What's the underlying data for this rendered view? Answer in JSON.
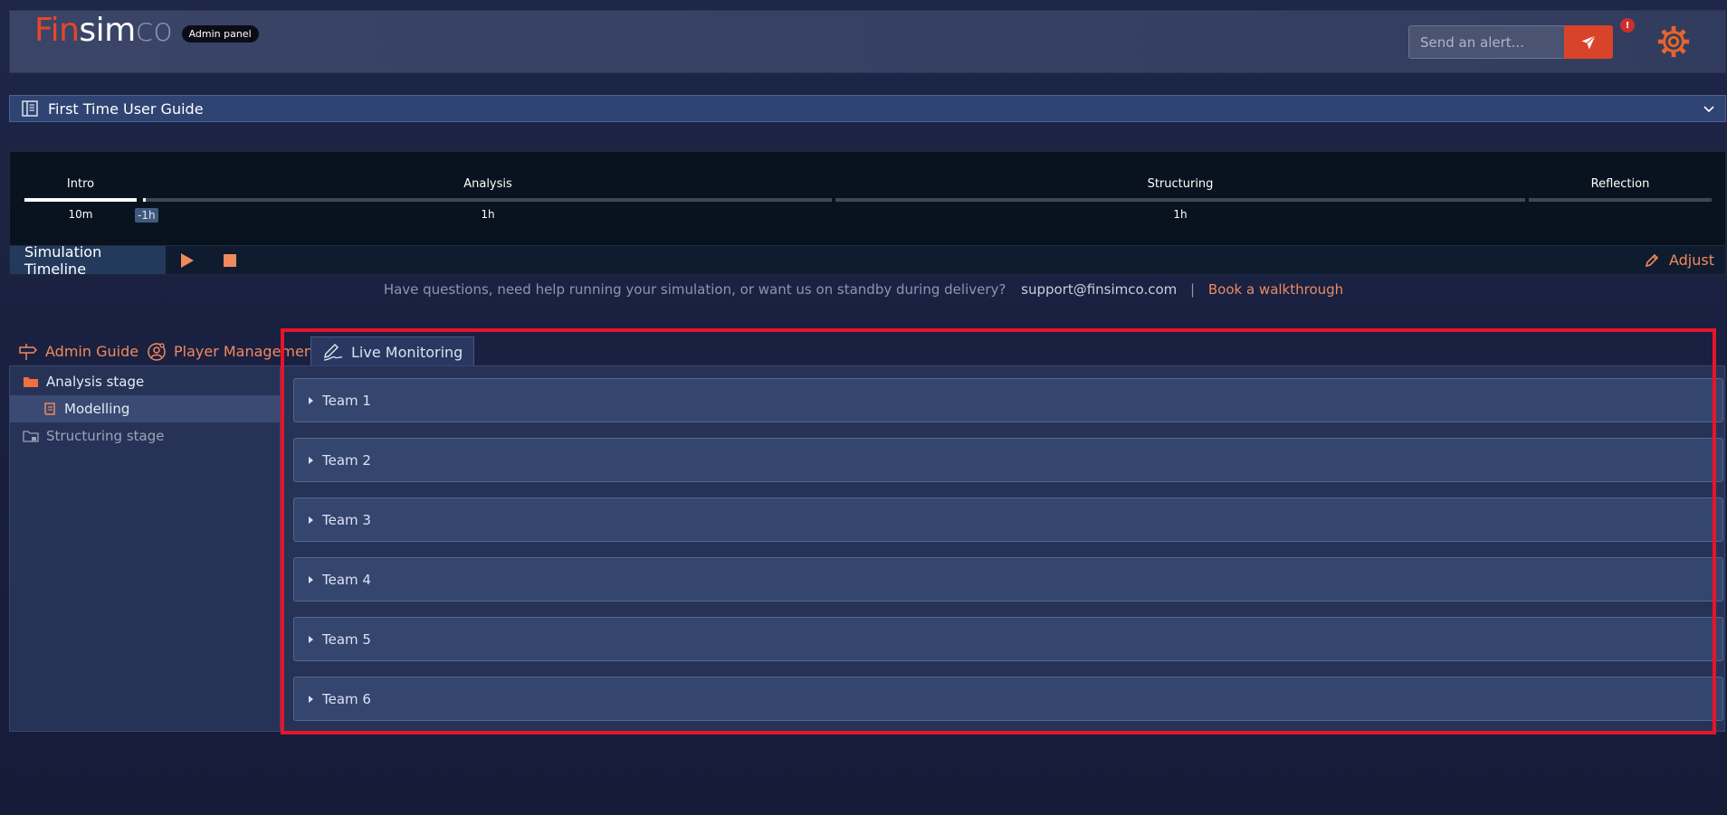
{
  "header": {
    "logo": {
      "part1": "Fin",
      "part2": "sim",
      "part3": "co"
    },
    "badge": "Admin panel",
    "alert_placeholder": "Send an alert...",
    "notification_count": "!"
  },
  "guide": {
    "title": "First Time User Guide"
  },
  "timeline": {
    "phases": [
      {
        "name": "Intro",
        "duration": "10m"
      },
      {
        "name": "Analysis",
        "duration": "1h"
      },
      {
        "name": "Structuring",
        "duration": "1h"
      },
      {
        "name": "Reflection",
        "duration": ""
      }
    ],
    "offset": "-1h",
    "label": "Simulation Timeline",
    "adjust_label": "Adjust"
  },
  "support": {
    "question": "Have questions, need help running your simulation, or want us on standby during delivery?",
    "email": "support@finsimco.com",
    "separator": "|",
    "book_link": "Book a walkthrough"
  },
  "tabs": [
    {
      "label": "Admin Guide",
      "active": false
    },
    {
      "label": "Player Management",
      "active": false
    },
    {
      "label": "Live Monitoring",
      "active": true
    }
  ],
  "tree": {
    "items": [
      {
        "label": "Analysis stage",
        "type": "folder-open"
      },
      {
        "label": "Modelling",
        "type": "file"
      },
      {
        "label": "Structuring stage",
        "type": "folder-locked"
      }
    ]
  },
  "teams": [
    "Team 1",
    "Team 2",
    "Team 3",
    "Team 4",
    "Team 5",
    "Team 6"
  ],
  "colors": {
    "accent": "#e5462c",
    "tab_inactive": "#f08a5d",
    "highlight": "#e8142a"
  }
}
